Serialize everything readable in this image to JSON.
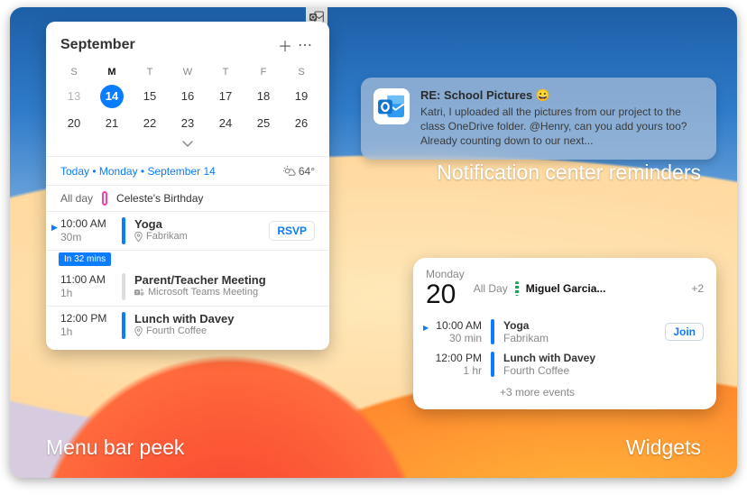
{
  "captions": {
    "menu": "Menu bar peek",
    "notif": "Notification center reminders",
    "widg": "Widgets"
  },
  "peek": {
    "month": "September",
    "weekdays": [
      "S",
      "M",
      "T",
      "W",
      "T",
      "F",
      "S"
    ],
    "days_row1": [
      "13",
      "14",
      "15",
      "16",
      "17",
      "18",
      "19"
    ],
    "days_row2": [
      "20",
      "21",
      "22",
      "23",
      "24",
      "25",
      "26"
    ],
    "today_day_index": 1,
    "today_line": "Today • Monday • September 14",
    "weather": "64°",
    "allday": {
      "label": "All day",
      "title": "Celeste's Birthday"
    },
    "soon_chip": "In 32 mins",
    "items": [
      {
        "time": "10:00 AM",
        "dur": "30m",
        "title": "Yoga",
        "loc": "Fabrikam",
        "bar": "blue",
        "current": true,
        "action": "RSVP",
        "icon": "pin"
      },
      {
        "time": "11:00 AM",
        "dur": "1h",
        "title": "Parent/Teacher Meeting",
        "loc": "Microsoft Teams Meeting",
        "bar": "blank",
        "icon": "teams"
      },
      {
        "time": "12:00 PM",
        "dur": "1h",
        "title": "Lunch with Davey",
        "loc": "Fourth Coffee",
        "bar": "blue",
        "icon": "pin"
      }
    ]
  },
  "notification": {
    "subject": "RE: School Pictures 😀",
    "preview": "Katri, I uploaded all the pictures from our project to the class OneDrive folder. @Henry, can you add yours too? Already counting down to our next..."
  },
  "widget": {
    "dow": "Monday",
    "day": "20",
    "allday_label": "All Day",
    "allday_title": "Miguel Garcia...",
    "more_count": "+2",
    "rows": [
      {
        "time": "10:00 AM",
        "dur": "30 min",
        "title": "Yoga",
        "loc": "Fabrikam",
        "current": true,
        "action": "Join"
      },
      {
        "time": "12:00 PM",
        "dur": "1 hr",
        "title": "Lunch with Davey",
        "loc": "Fourth Coffee"
      }
    ],
    "more_events": "+3 more events"
  }
}
